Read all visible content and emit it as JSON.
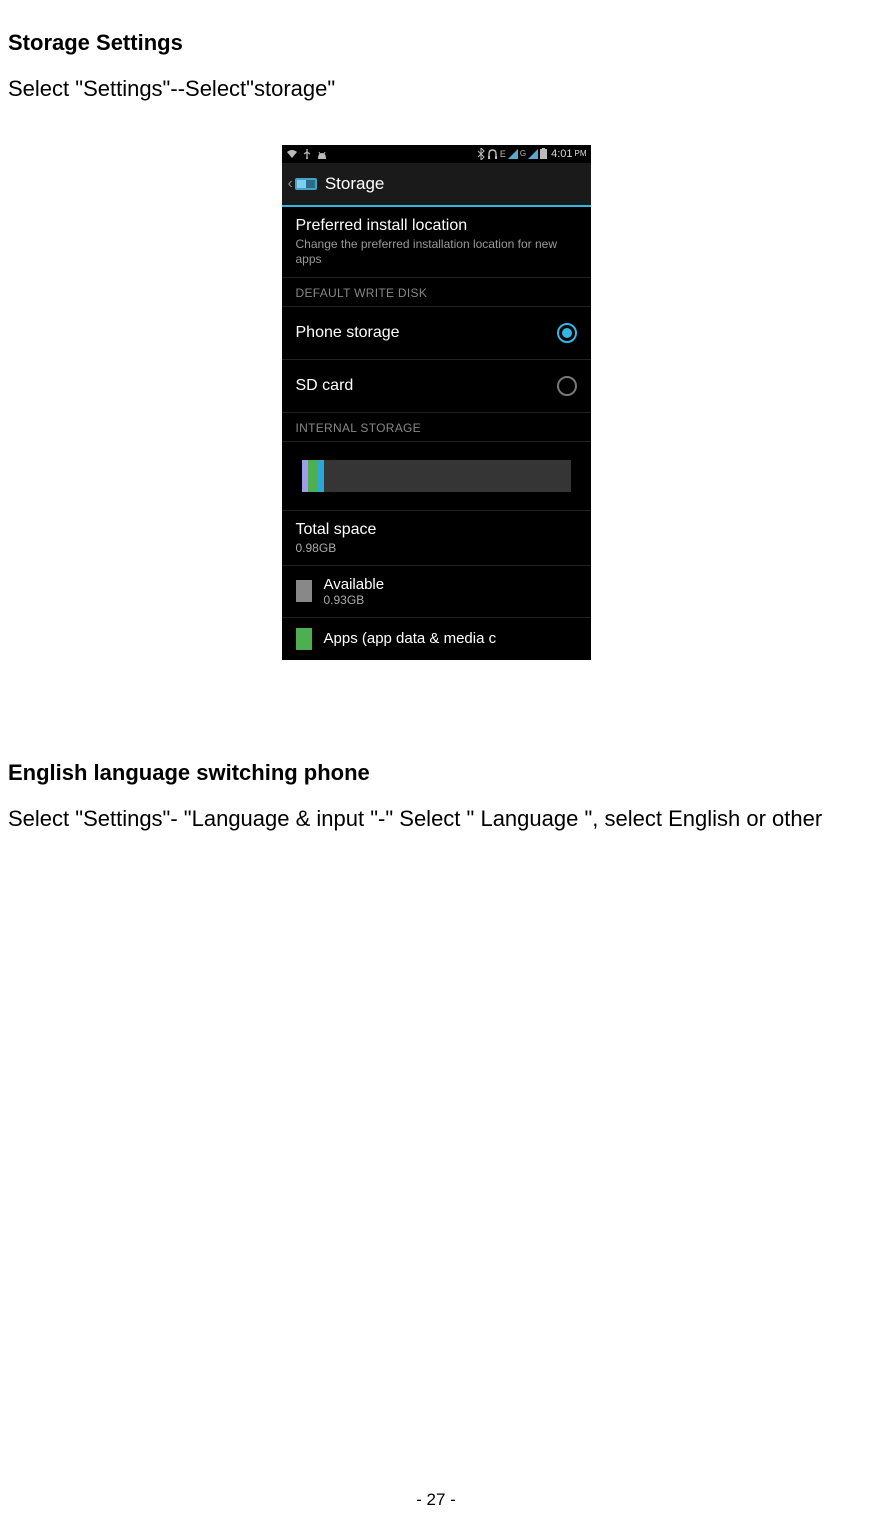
{
  "doc": {
    "section1_heading": "Storage Settings",
    "section1_body": "Select \"Settings\"--Select\"storage\"",
    "section2_heading": "English language switching phone",
    "section2_body": "Select \"Settings\"- \"Language & input \"-\" Select \" Language \", select English or other",
    "page_number": "- 27 -"
  },
  "phone": {
    "status": {
      "network_flag": "E",
      "signal_sup": "G",
      "time": "4:01",
      "meridiem": "PM"
    },
    "titlebar": "Storage",
    "pref_install": {
      "title": "Preferred install location",
      "subtitle": "Change the preferred installation location for new apps"
    },
    "section_default_write": "DEFAULT WRITE DISK",
    "radios": {
      "phone_storage": "Phone storage",
      "sd_card": "SD card"
    },
    "section_internal": "INTERNAL STORAGE",
    "total": {
      "label": "Total space",
      "value": "0.98GB"
    },
    "available": {
      "label": "Available",
      "value": "0.93GB"
    },
    "apps_row": "Apps (app data & media c"
  }
}
